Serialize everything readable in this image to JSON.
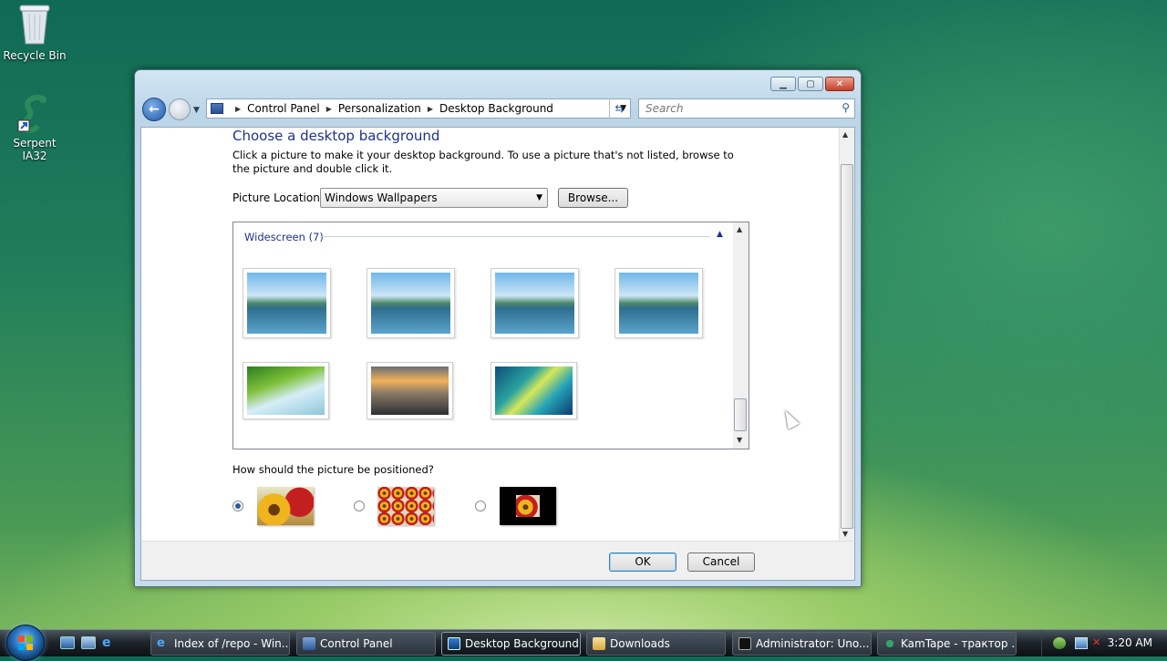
{
  "desktop": {
    "icons": [
      {
        "label": "Recycle Bin",
        "icon": "recycle-bin-icon"
      },
      {
        "label": "Serpent IA32",
        "icon": "serpent-icon"
      }
    ]
  },
  "window": {
    "title": "Desktop Background",
    "address": {
      "crumbs": [
        "Control Panel",
        "Personalization",
        "Desktop Background"
      ]
    },
    "search": {
      "placeholder": "Search"
    },
    "heading": "Choose a desktop background",
    "description": "Click a picture to make it your desktop background. To use a picture that's not listed, browse to the picture and double click it.",
    "picture_location": {
      "label": "Picture Location",
      "value": "Windows Wallpapers",
      "browse_label": "Browse..."
    },
    "gallery": {
      "group_label": "Widescreen (7)",
      "items": [
        {
          "name": "lake-1"
        },
        {
          "name": "lake-2"
        },
        {
          "name": "lake-3"
        },
        {
          "name": "lake-4"
        },
        {
          "name": "leaf"
        },
        {
          "name": "rocks"
        },
        {
          "name": "aurora"
        }
      ]
    },
    "position": {
      "question": "How should the picture be positioned?",
      "options": [
        "fit-to-screen",
        "tile",
        "center"
      ],
      "selected": "fit-to-screen"
    },
    "buttons": {
      "ok": "OK",
      "cancel": "Cancel"
    }
  },
  "taskbar": {
    "tasks": [
      {
        "label": "Index of /repo - Win...",
        "icon": "ie-icon",
        "active": false
      },
      {
        "label": "Control Panel",
        "icon": "control-panel-icon",
        "active": false
      },
      {
        "label": "Desktop Background",
        "icon": "desktop-background-icon",
        "active": true
      },
      {
        "label": "Downloads",
        "icon": "folder-icon",
        "active": false
      },
      {
        "label": "Administrator: Uno...",
        "icon": "cmd-icon",
        "active": false
      },
      {
        "label": "KamTape - трактор ...",
        "icon": "serpent-icon",
        "active": false
      }
    ],
    "clock": "3:20 AM"
  },
  "colors": {
    "accent": "#1e3287",
    "taskbar": "#1e252c"
  }
}
